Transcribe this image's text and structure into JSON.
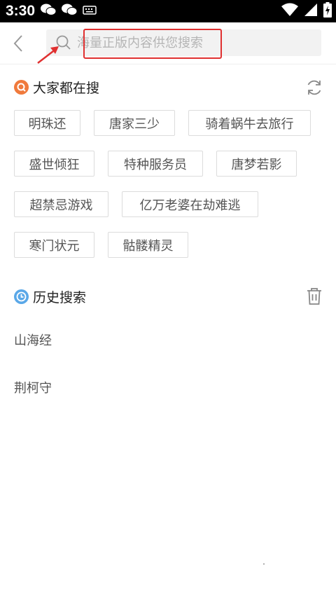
{
  "status_bar": {
    "time": "3:30",
    "left_icons": [
      "wechat-icon",
      "wechat-icon",
      "keyboard-icon"
    ],
    "right_icons": [
      "wifi-icon",
      "signal-icon",
      "battery-icon"
    ]
  },
  "search": {
    "placeholder": "海量正版内容供您搜索",
    "value": ""
  },
  "hot_search": {
    "title": "大家都在搜",
    "tags": [
      "明珠还",
      "唐家三少",
      "骑着蜗牛去旅行",
      "盛世倾狂",
      "特种服务员",
      "唐梦若影",
      "超禁忌游戏",
      "亿万老婆在劫难逃",
      "寒门状元",
      "骷髅精灵"
    ]
  },
  "history": {
    "title": "历史搜索",
    "items": [
      "山海经",
      "荆柯守"
    ]
  },
  "colors": {
    "accent": "#f07a3c",
    "history_icon": "#5aa8e8",
    "highlight": "#e03030"
  }
}
